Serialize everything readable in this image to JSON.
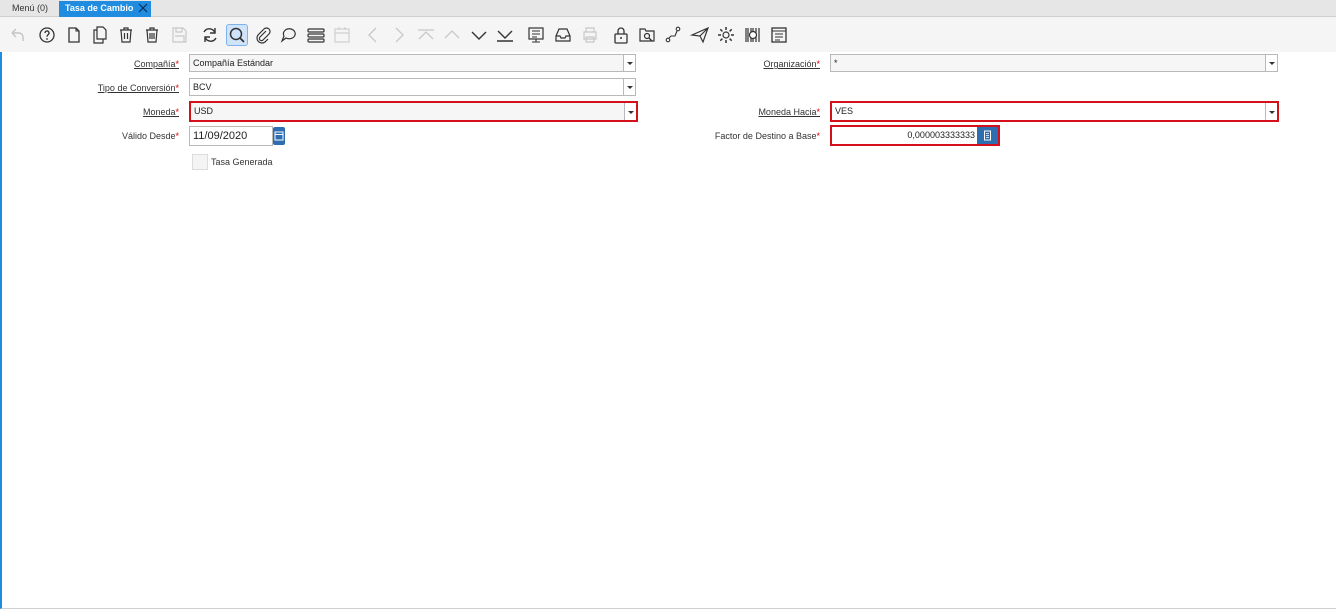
{
  "tabs": {
    "menu": "Menú (0)",
    "active": "Tasa de Cambio"
  },
  "toolbar": {
    "icons": [
      "undo-icon",
      "help-icon",
      "new-record-icon",
      "copy-record-icon",
      "delete-icon",
      "delete-selection-icon",
      "save-icon",
      "refresh-icon",
      "find-icon",
      "attachment-icon",
      "chat-icon",
      "grid-toggle-icon",
      "calendar-icon",
      "previous-icon",
      "next-icon",
      "first-record-icon",
      "parent-record-icon",
      "detail-record-icon",
      "last-record-icon",
      "report-icon",
      "archive-icon",
      "print-icon",
      "lock-icon",
      "zoom-across-icon",
      "workflow-icon",
      "send-request-icon",
      "process-icon",
      "product-info-icon",
      "print-preview-icon"
    ]
  },
  "form": {
    "compania": {
      "label": "Compañía",
      "value": "Compañía Estándar"
    },
    "organizacion": {
      "label": "Organización",
      "value": "*"
    },
    "tipo_conversion": {
      "label": "Tipo de Conversión",
      "value": "BCV"
    },
    "moneda": {
      "label": "Moneda",
      "value": "USD"
    },
    "moneda_hacia": {
      "label": "Moneda Hacia",
      "value": "VES"
    },
    "valido_desde": {
      "label": "Válido Desde",
      "value": "11/09/2020"
    },
    "factor": {
      "label": "Factor de Destino a Base",
      "value": "0,000003333333"
    },
    "tasa_generada": {
      "label": "Tasa Generada"
    },
    "required_mark": "*"
  },
  "colors": {
    "accent": "#1f8ce0",
    "error_border": "#d4101a",
    "required": "#dd0000"
  }
}
